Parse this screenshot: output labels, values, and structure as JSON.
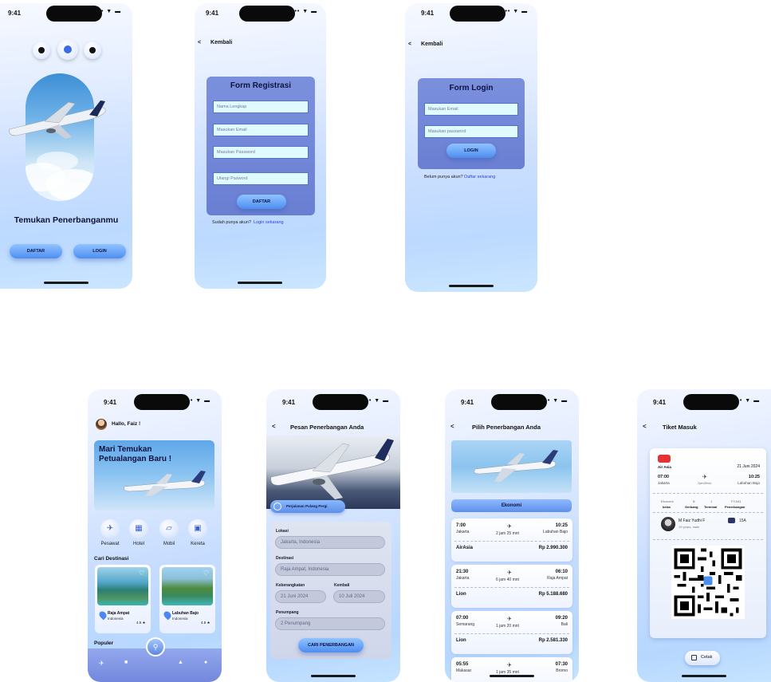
{
  "status": {
    "time": "9:41",
    "icons": "••• ▼ ▬"
  },
  "screen1": {
    "headline": "Temukan Penerbanganmu",
    "register_label": "DAFTAR",
    "login_label": "LOGIN"
  },
  "screen2": {
    "back_label": "Kembali",
    "title": "Form Registrasi",
    "fields": [
      "Nama Lengkap",
      "Masukan Email",
      "Masukan Password",
      "Ulangi Pasword"
    ],
    "submit_label": "DAFTAR",
    "footer_text": "Sudah punya akun?",
    "footer_link": "Login sekarang"
  },
  "screen3": {
    "back_label": "Kembali",
    "title": "Form Login",
    "fields": [
      "Masukan Email",
      "Masukan password"
    ],
    "submit_label": "LOGIN",
    "footer_text": "Belum punya akun?",
    "footer_link": "Daftar sekarang"
  },
  "screen4": {
    "greeting": "Hallo, Faiz !",
    "banner_title": "Mari Temukan Petualangan Baru !",
    "categories": [
      {
        "label": "Pesawat",
        "icon": "plane-icon",
        "glyph": "✈"
      },
      {
        "label": "Hotel",
        "icon": "hotel-icon",
        "glyph": "▦"
      },
      {
        "label": "Mobil",
        "icon": "car-icon",
        "glyph": "▱"
      },
      {
        "label": "Kereta",
        "icon": "train-icon",
        "glyph": "▣"
      }
    ],
    "section_destinations": "Cari Destinasi",
    "destinations": [
      {
        "name": "Raja Ampat",
        "country": "Indonesia",
        "rating": "4.5 ★"
      },
      {
        "name": "Labuhan Bajo",
        "country": "Indonesia",
        "rating": "4.5 ★"
      }
    ],
    "section_popular": "Populer"
  },
  "screen5": {
    "title": "Pesan Penerbangan Anda",
    "trip_type": "Perjalanan Pulang Pergi",
    "location_label": "Lokasi",
    "location_value": "Jakarta, Indonesia",
    "destination_label": "Destinasi",
    "destination_value": "Raja Ampat, Indonesia",
    "depart_label": "Keberangkatan",
    "depart_value": "21 Juni 2024",
    "return_label": "Kembali",
    "return_value": "10 Juli 2024",
    "passenger_label": "Penumpang",
    "passenger_value": "2 Penumpang",
    "search_label": "CARI PENERBANGAN"
  },
  "screen6": {
    "title": "Pilih Penerbangan Anda",
    "class_label": "Ekonomi",
    "flights": [
      {
        "dep_time": "7:00",
        "dep_city": "Jakarta",
        "duration": "2 jam 25 mnt",
        "arr_time": "10:25",
        "arr_city": "Labuhan Bajo",
        "airline": "AirAsia",
        "price": "Rp 2.990.300"
      },
      {
        "dep_time": "21:30",
        "dep_city": "Jakarta",
        "duration": "6 jam 40 mnt",
        "arr_time": "06:10",
        "arr_city": "Raja Ampat",
        "airline": "Lion",
        "price": "Rp 5.188.680"
      },
      {
        "dep_time": "07:00",
        "dep_city": "Semarang",
        "duration": "1 jam 20 mnt",
        "arr_time": "09:20",
        "arr_city": "Bali",
        "airline": "Lion",
        "price": "Rp 2.581.330"
      },
      {
        "dep_time": "05:55",
        "dep_city": "Makasar",
        "duration": "1 jam 35 mnt",
        "arr_time": "07:30",
        "arr_city": "Bromo",
        "airline": "",
        "price": ""
      }
    ]
  },
  "screen7": {
    "title": "Tiket Masuk",
    "airline": "Air Asia",
    "date": "21 Juni 2024",
    "dep_time": "07:00",
    "dep_city": "Jakarta",
    "duration": "2jam25mnt",
    "arr_time": "10:25",
    "arr_city": "Labuhan Bajo",
    "detail_values": [
      "Ekonomi",
      "B",
      "1",
      "FY-641"
    ],
    "detail_labels": [
      "kelas",
      "Gerbang",
      "Terminal",
      "Penerbangan"
    ],
    "passenger_name": "M Faiz Yudhi F",
    "passenger_info": "19 years, male",
    "seat": "15A",
    "print_label": "Cetak"
  },
  "colors": {
    "accent": "#4f8df0",
    "card": "#6f84d6",
    "nav": "#7f93e2"
  }
}
